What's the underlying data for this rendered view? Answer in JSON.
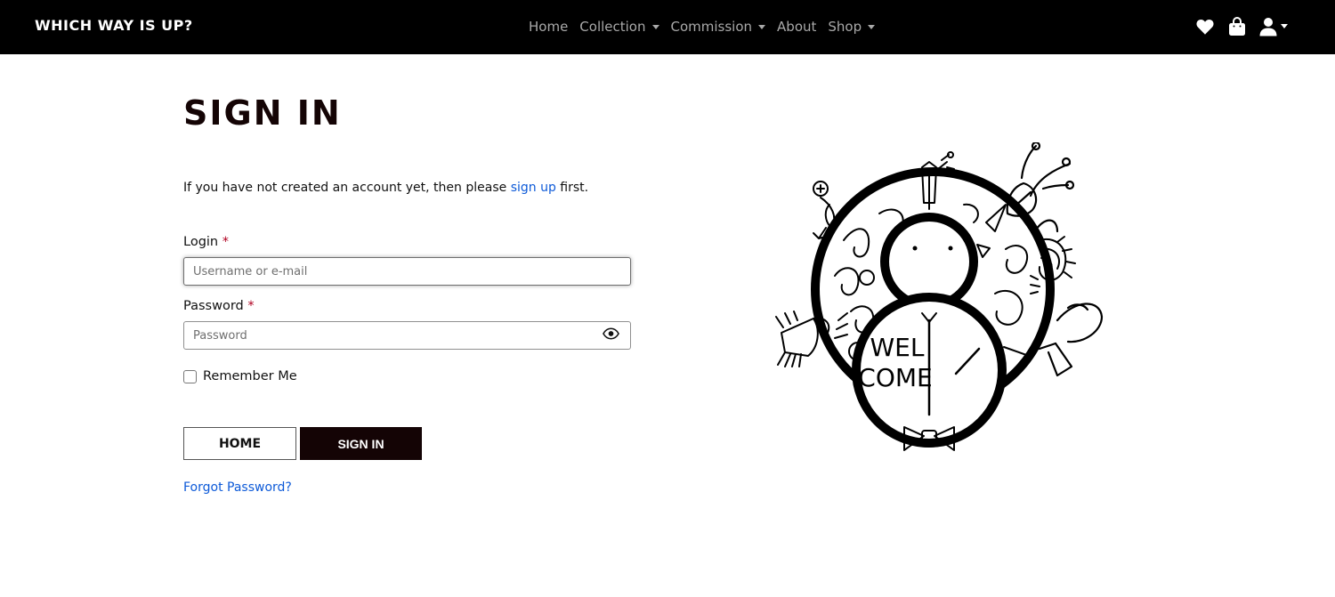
{
  "nav": {
    "brand": "WHICH WAY IS UP?",
    "links": [
      {
        "label": "Home",
        "dropdown": false
      },
      {
        "label": "Collection",
        "dropdown": true
      },
      {
        "label": "Commission",
        "dropdown": true
      },
      {
        "label": "About",
        "dropdown": false
      },
      {
        "label": "Shop",
        "dropdown": true
      }
    ],
    "icons": [
      "heart-icon",
      "shopping-bag-icon",
      "user-icon"
    ]
  },
  "main": {
    "title": "SIGN IN",
    "intro_before": "If you have not created an account yet, then please ",
    "intro_link": "sign up",
    "intro_after": " first.",
    "login_label": "Login",
    "login_placeholder": "Username or e-mail",
    "password_label": "Password",
    "password_placeholder": "Password",
    "required_marker": "*",
    "remember_label": "Remember Me",
    "home_button": "HOME",
    "signin_button": "SIGN IN",
    "forgot_link": "Forgot Password?"
  },
  "illustration": {
    "text_line1": "WEL",
    "text_line2": "COME"
  },
  "colors": {
    "navbar_bg": "#000000",
    "nav_link": "#a9a9a9",
    "accent_dark": "#140405",
    "link_blue": "#0d5ad8",
    "required_red": "#b00020"
  }
}
